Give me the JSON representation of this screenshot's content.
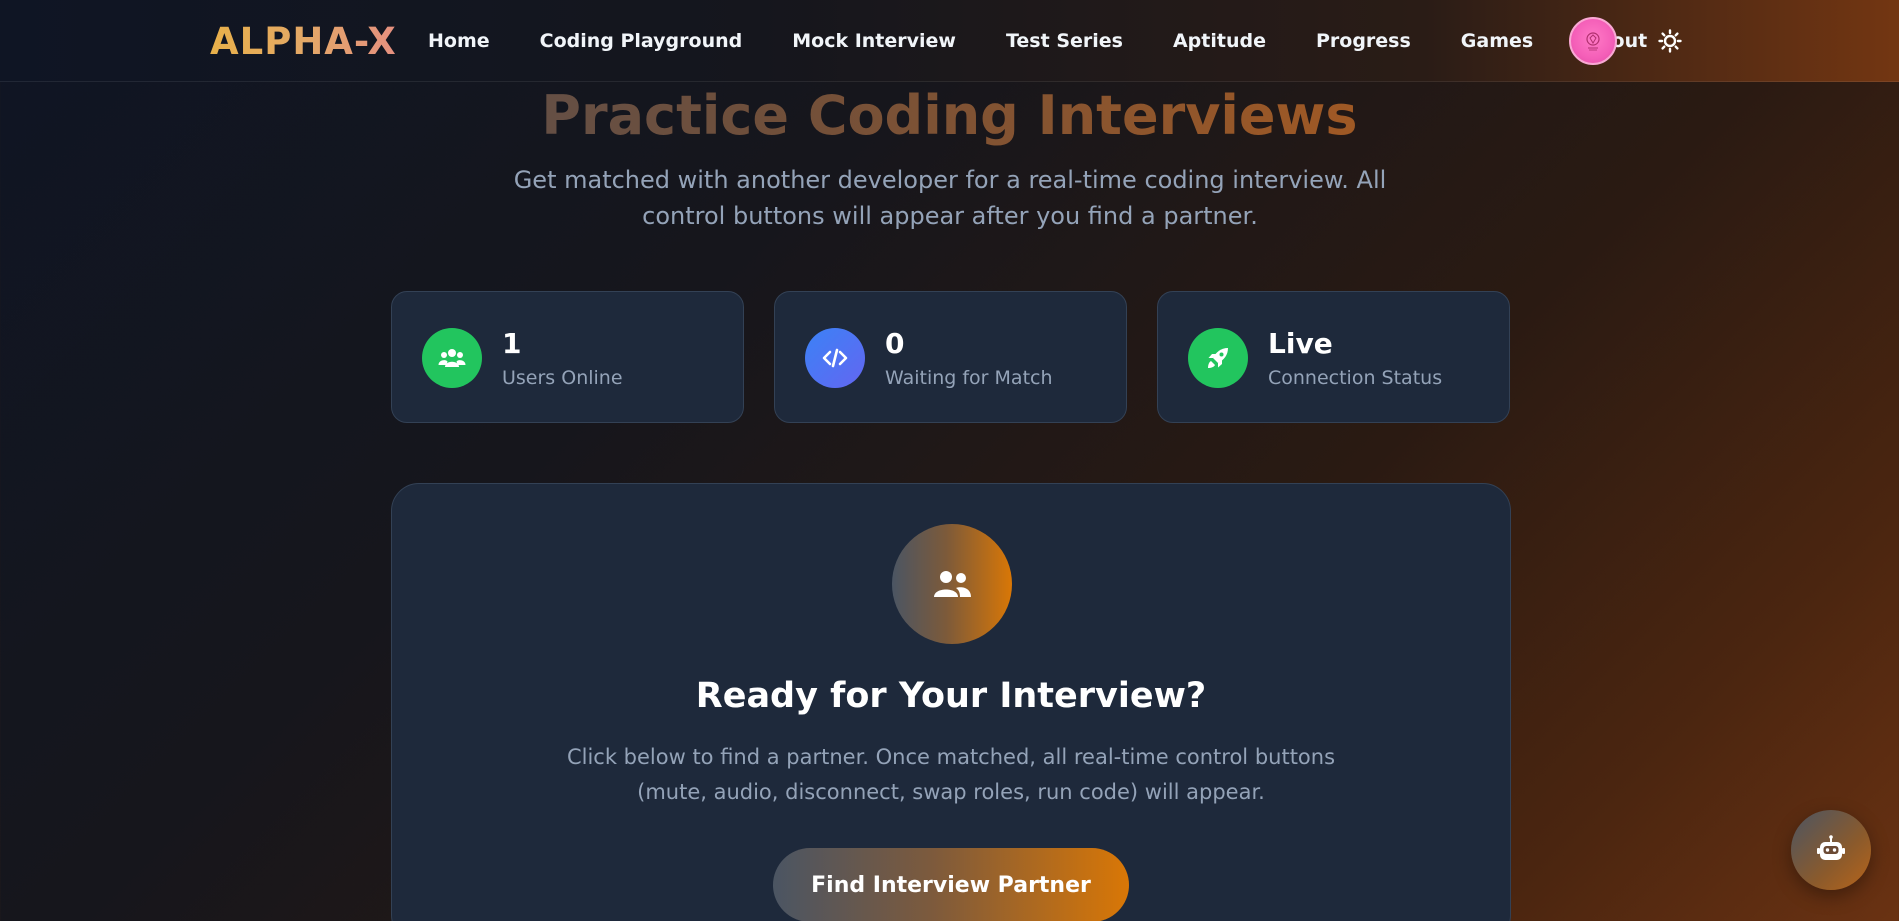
{
  "brand": {
    "name": "ALPHA-X"
  },
  "nav": {
    "links": [
      "Home",
      "Coding Playground",
      "Mock Interview",
      "Test Series",
      "Aptitude",
      "Progress",
      "Games",
      "About"
    ]
  },
  "icons": {
    "avatar": "user-avatar",
    "theme": "sun-icon",
    "users": "users-icon",
    "code": "code-icon",
    "rocket": "rocket-icon",
    "partner": "user-friends-icon",
    "chatbot": "robot-icon"
  },
  "hero": {
    "title": "Practice Coding Interviews",
    "subtitle": "Get matched with another developer for a real-time coding interview. All control buttons will appear after you find a partner."
  },
  "stats": [
    {
      "value": "1",
      "label": "Users Online",
      "color": "#22c55e"
    },
    {
      "value": "0",
      "label": "Waiting for Match",
      "color": "#6366f1"
    },
    {
      "value": "Live",
      "label": "Connection Status",
      "color": "#22c55e"
    }
  ],
  "panel": {
    "title": "Ready for Your Interview?",
    "text": "Click below to find a partner. Once matched, all real-time control buttons (mute, audio, disconnect, swap roles, run code) will appear.",
    "button": "Find Interview Partner"
  },
  "colors": {
    "accent": "#d97706",
    "card_bg": "#1e293b",
    "muted_text": "#94a3b8",
    "avatar_pink": "#f45fb8"
  }
}
